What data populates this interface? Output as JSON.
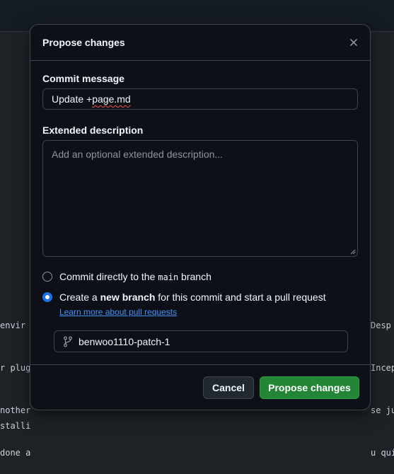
{
  "background": {
    "left_lines": [
      "envir",
      "r plug",
      "nother",
      "done a",
      "",
      "",
      "",
      "",
      "stalli"
    ],
    "right_lines": [
      "Desp",
      "Incep",
      "se ju",
      "u qui"
    ]
  },
  "modal": {
    "title": "Propose changes",
    "commit_message_label": "Commit message",
    "commit_message_value_prefix": "Update +",
    "commit_message_value_spell": "page.md",
    "extended_description_label": "Extended description",
    "extended_description_placeholder": "Add an optional extended description...",
    "option_direct": {
      "prefix": "Commit directly to the ",
      "branch": "main",
      "suffix": " branch",
      "checked": false
    },
    "option_new_branch": {
      "prefix": "Create a ",
      "bold": "new branch",
      "suffix": " for this commit and start a pull request",
      "checked": true
    },
    "learn_more_link": "Learn more about pull requests",
    "branch_name": "benwoo1110-patch-1",
    "cancel_label": "Cancel",
    "propose_label": "Propose changes"
  },
  "colors": {
    "accent_blue": "#1f6feb",
    "primary_green": "#238636",
    "link": "#4493f8"
  }
}
